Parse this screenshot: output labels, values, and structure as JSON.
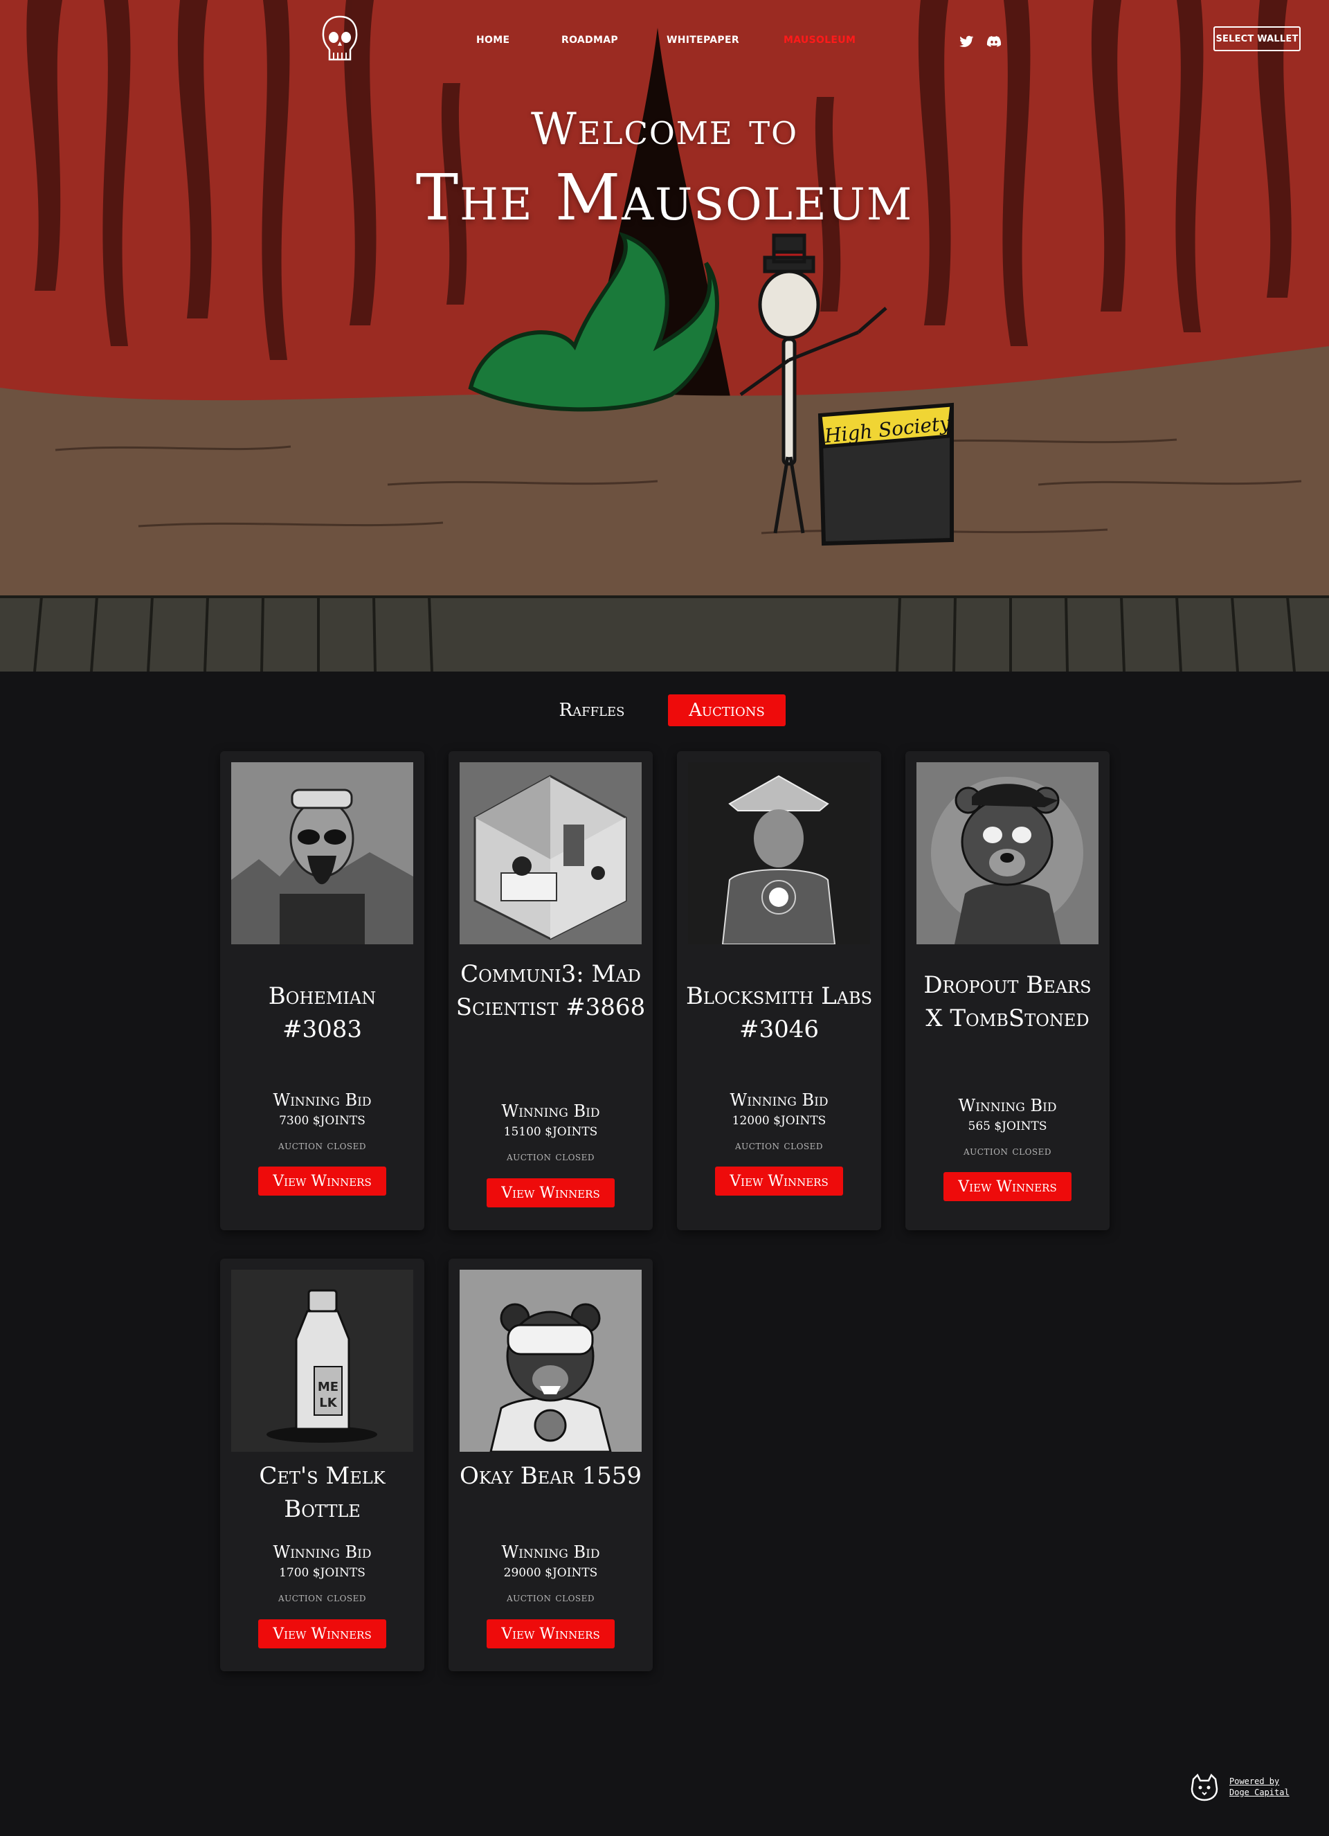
{
  "nav": {
    "links": [
      "HOME",
      "ROADMAP",
      "WHITEPAPER",
      "MAUSOLEUM"
    ],
    "active": "MAUSOLEUM",
    "wallet_button": "SELECT WALLET",
    "social_icons": [
      "twitter-icon",
      "discord-icon"
    ],
    "logo": "skull-logo"
  },
  "hero": {
    "welcome": "Welcome to",
    "title": "The Mausoleum",
    "podium_text": "High Society"
  },
  "tabs": {
    "items": [
      "Raffles",
      "Auctions"
    ],
    "active": "Auctions"
  },
  "cards": [
    {
      "name": "Bohemian #3083",
      "bid_label": "Winning Bid",
      "bid_value": "7300 $JOINTS",
      "status": "auction closed",
      "button": "View Winners"
    },
    {
      "name": "Communi3: Mad Scientist #3868",
      "bid_label": "Winning Bid",
      "bid_value": "15100 $JOINTS",
      "status": "auction closed",
      "button": "View Winners"
    },
    {
      "name": "Blocksmith Labs #3046",
      "bid_label": "Winning Bid",
      "bid_value": "12000 $JOINTS",
      "status": "auction closed",
      "button": "View Winners"
    },
    {
      "name": "Dropout Bears X TombStoned",
      "bid_label": "Winning Bid",
      "bid_value": "565 $JOINTS",
      "status": "auction closed",
      "button": "View Winners"
    },
    {
      "name": "Cet's Melk Bottle",
      "bid_label": "Winning Bid",
      "bid_value": "1700 $JOINTS",
      "status": "auction closed",
      "button": "View Winners"
    },
    {
      "name": "Okay Bear 1559",
      "bid_label": "Winning Bid",
      "bid_value": "29000 $JOINTS",
      "status": "auction closed",
      "button": "View Winners"
    }
  ],
  "footer": {
    "powered_line1": "Powered by",
    "powered_line2": "Doge Capital"
  },
  "colors": {
    "accent_red": "#ee0b0b",
    "background": "#131315",
    "card": "#1d1d1f",
    "curtain": "#9a2a21"
  }
}
